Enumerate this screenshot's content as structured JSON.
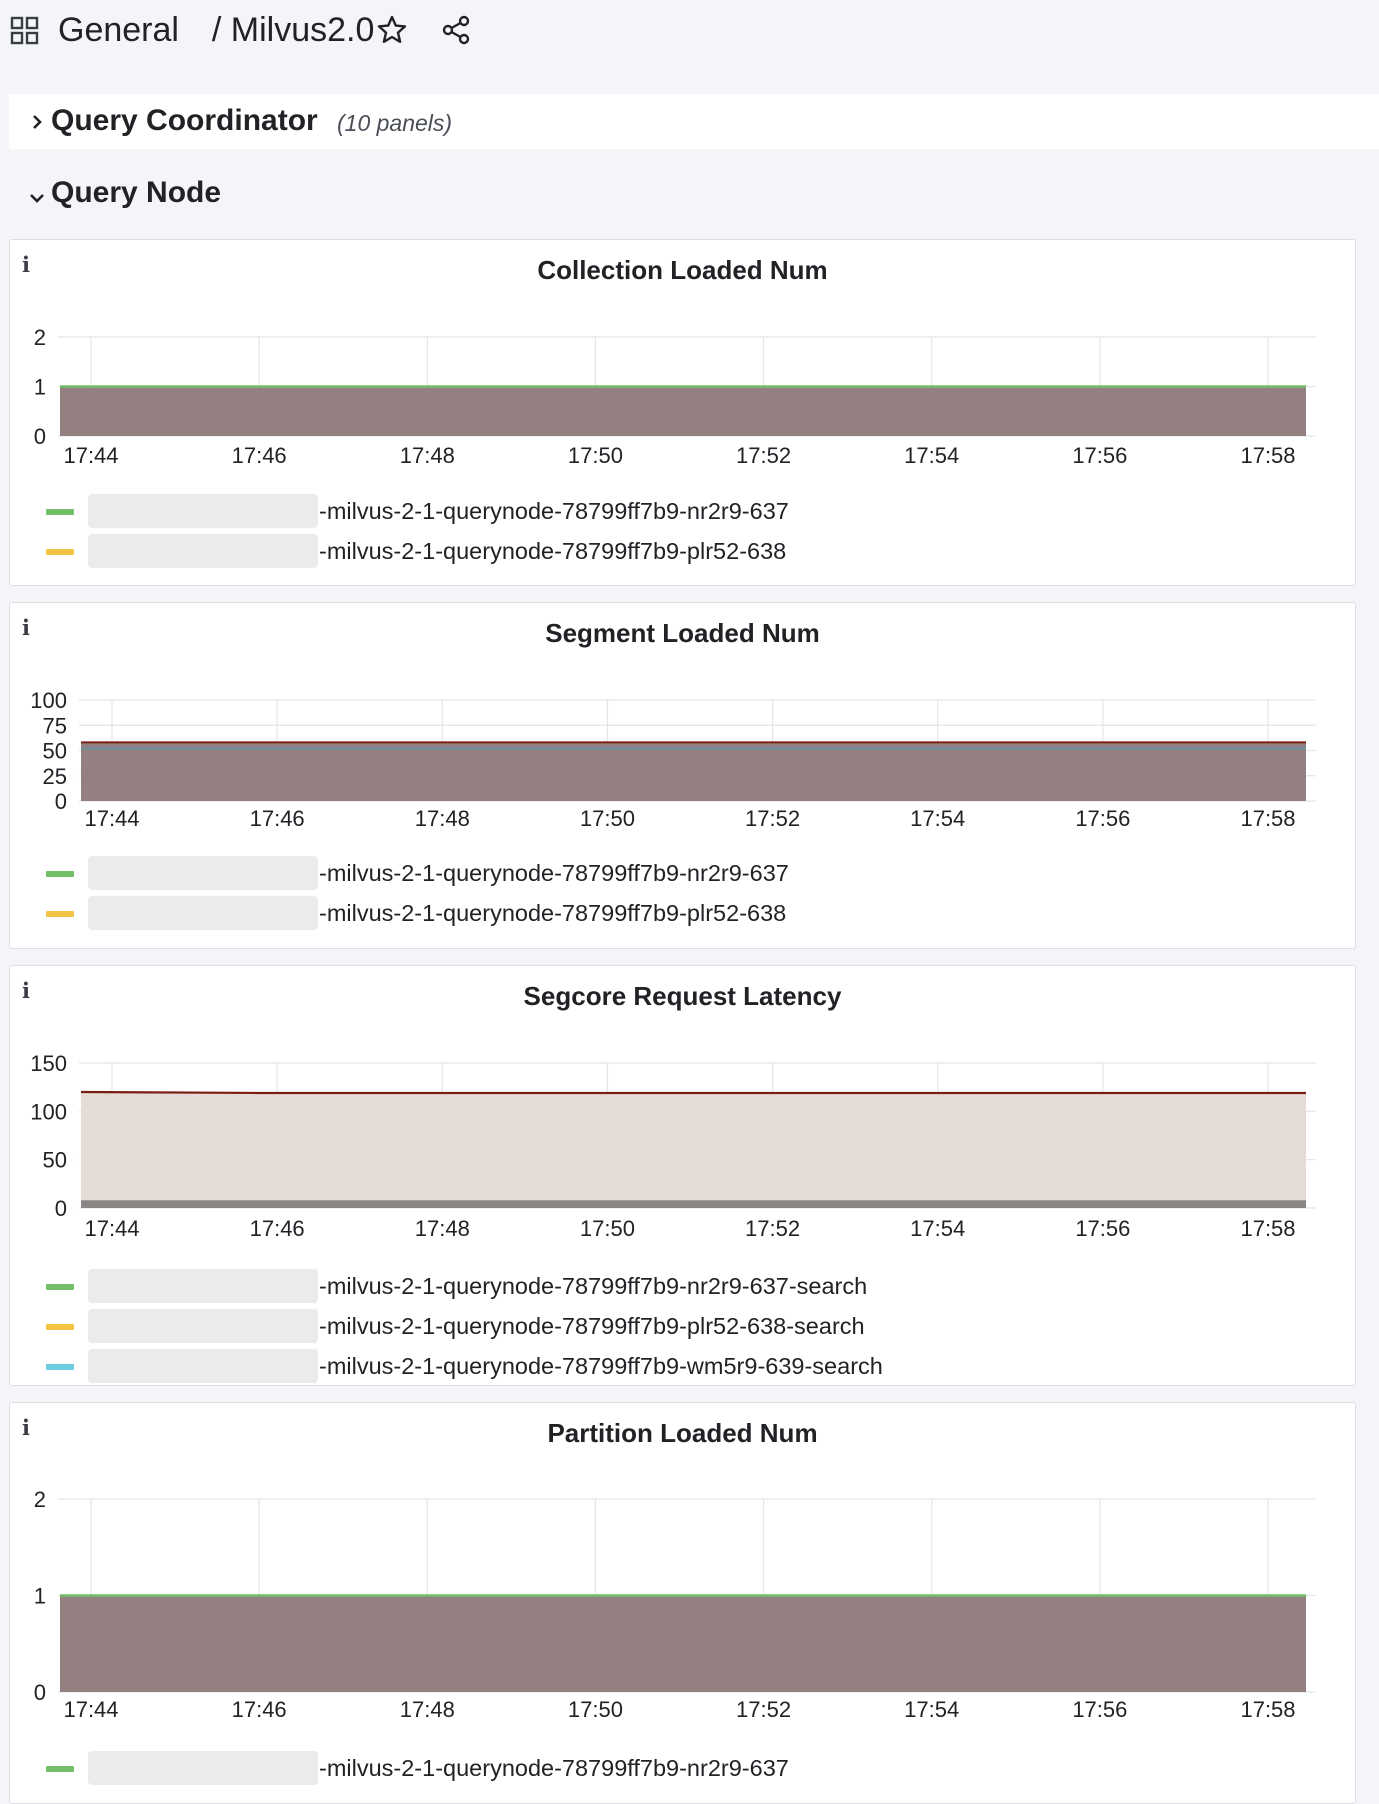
{
  "breadcrumb": {
    "folder": "General",
    "separator": "/",
    "dashboard": "Milvus2.0"
  },
  "rows": {
    "query_coordinator": {
      "title": "Query Coordinator",
      "count": "(10 panels)",
      "state": "collapsed"
    },
    "query_node": {
      "title": "Query Node",
      "state": "expanded"
    }
  },
  "colors": {
    "green": "#73bf69",
    "yellow": "#f2c444",
    "cyan": "#6ccce0",
    "fill": "#958081",
    "fill_light": "#e5dcd8",
    "dark_line": "#7a1e12"
  },
  "panels": [
    {
      "title": "Collection Loaded Num",
      "legend": [
        {
          "label": "-milvus-2-1-querynode-78799ff7b9-nr2r9-637",
          "color": "#73bf69"
        },
        {
          "label": "-milvus-2-1-querynode-78799ff7b9-plr52-638",
          "color": "#f2c444"
        }
      ]
    },
    {
      "title": "Segment Loaded Num",
      "legend": [
        {
          "label": "-milvus-2-1-querynode-78799ff7b9-nr2r9-637",
          "color": "#73bf69"
        },
        {
          "label": "-milvus-2-1-querynode-78799ff7b9-plr52-638",
          "color": "#f2c444"
        }
      ]
    },
    {
      "title": "Segcore Request Latency",
      "legend": [
        {
          "label": "-milvus-2-1-querynode-78799ff7b9-nr2r9-637-search",
          "color": "#73bf69"
        },
        {
          "label": "-milvus-2-1-querynode-78799ff7b9-plr52-638-search",
          "color": "#f2c444"
        },
        {
          "label": "-milvus-2-1-querynode-78799ff7b9-wm5r9-639-search",
          "color": "#6ccce0"
        }
      ]
    },
    {
      "title": "Partition Loaded Num",
      "legend": [
        {
          "label": "-milvus-2-1-querynode-78799ff7b9-nr2r9-637",
          "color": "#73bf69"
        }
      ]
    }
  ],
  "chart_data": [
    {
      "type": "area",
      "title": "Collection Loaded Num",
      "x": [
        "17:44",
        "17:46",
        "17:48",
        "17:50",
        "17:52",
        "17:54",
        "17:56",
        "17:58"
      ],
      "yticks": [
        0,
        1,
        2
      ],
      "ylim": [
        0,
        2
      ],
      "grid": true,
      "series": [
        {
          "name": "-milvus-2-1-querynode-78799ff7b9-nr2r9-637",
          "values": [
            1,
            1,
            1,
            1,
            1,
            1,
            1,
            1
          ]
        }
      ]
    },
    {
      "type": "area",
      "title": "Segment Loaded Num",
      "x": [
        "17:44",
        "17:46",
        "17:48",
        "17:50",
        "17:52",
        "17:54",
        "17:56",
        "17:58"
      ],
      "yticks": [
        0,
        25,
        50,
        75,
        100
      ],
      "ylim": [
        0,
        100
      ],
      "grid": true,
      "series": [
        {
          "values": [
            58,
            58,
            58,
            58,
            58,
            58,
            58,
            58
          ]
        },
        {
          "values": [
            52,
            52,
            52,
            52,
            52,
            52,
            52,
            52
          ]
        }
      ]
    },
    {
      "type": "area",
      "title": "Segcore Request Latency",
      "x": [
        "17:44",
        "17:46",
        "17:48",
        "17:50",
        "17:52",
        "17:54",
        "17:56",
        "17:58"
      ],
      "yticks": [
        0,
        50,
        100,
        150
      ],
      "ylim": [
        0,
        150
      ],
      "grid": true,
      "series": [
        {
          "values": [
            120,
            119,
            119,
            119,
            119,
            119,
            119,
            119
          ]
        },
        {
          "values": [
            8,
            8,
            8,
            8,
            8,
            8,
            8,
            8
          ]
        }
      ]
    },
    {
      "type": "area",
      "title": "Partition Loaded Num",
      "x": [
        "17:44",
        "17:46",
        "17:48",
        "17:50",
        "17:52",
        "17:54",
        "17:56",
        "17:58"
      ],
      "yticks": [
        0,
        1,
        2
      ],
      "ylim": [
        0,
        2
      ],
      "grid": true,
      "series": [
        {
          "name": "-milvus-2-1-querynode-78799ff7b9-nr2r9-637",
          "values": [
            1,
            1,
            1,
            1,
            1,
            1,
            1,
            1
          ]
        }
      ]
    }
  ]
}
